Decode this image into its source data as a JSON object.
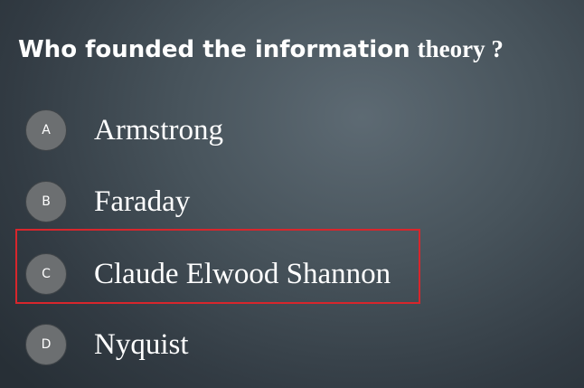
{
  "question": {
    "part1": "Who founded the information",
    "part2": "theory ?"
  },
  "options": [
    {
      "letter": "A",
      "text": "Armstrong"
    },
    {
      "letter": "B",
      "text": "Faraday"
    },
    {
      "letter": "C",
      "text": "Claude Elwood Shannon"
    },
    {
      "letter": "D",
      "text": "Nyquist"
    }
  ],
  "highlighted_option": "C",
  "colors": {
    "highlight_border": "#d8262c",
    "badge_fill": "#6c6f71",
    "text": "#ffffff",
    "background": "#3b464e"
  }
}
